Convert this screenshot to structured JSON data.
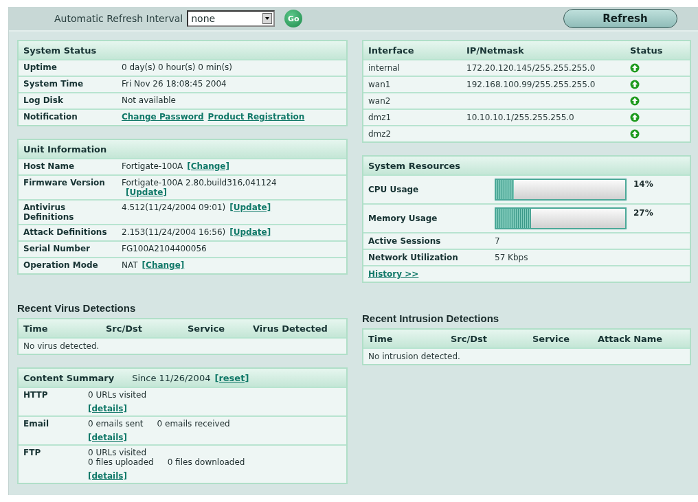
{
  "toolbar": {
    "interval_label": "Automatic Refresh Interval",
    "interval_value": "none",
    "go_button": "Go",
    "refresh_button": "Refresh"
  },
  "system_status": {
    "title": "System Status",
    "rows": [
      {
        "label": "Uptime",
        "parts": [
          {
            "kind": "text",
            "text": "0 day(s) 0 hour(s) 0 min(s)"
          }
        ]
      },
      {
        "label": "System Time",
        "parts": [
          {
            "kind": "text",
            "text": "Fri Nov 26 18:08:45 2004"
          }
        ]
      },
      {
        "label": "Log Disk",
        "parts": [
          {
            "kind": "text",
            "text": "Not available"
          }
        ]
      },
      {
        "label": "Notification",
        "parts": [
          {
            "kind": "link",
            "text": "Change Password"
          },
          {
            "kind": "link",
            "text": "Product Registration"
          }
        ]
      }
    ]
  },
  "unit_information": {
    "title": "Unit Information",
    "rows": [
      {
        "label": "Host Name",
        "parts": [
          {
            "kind": "text",
            "text": "Fortigate-100A"
          },
          {
            "kind": "link",
            "text": "[Change]"
          }
        ]
      },
      {
        "label": "Firmware Version",
        "parts": [
          {
            "kind": "text",
            "text": "Fortigate-100A 2.80,build316,041124"
          },
          {
            "kind": "link",
            "text": "[Update]",
            "newline": true
          }
        ]
      },
      {
        "label": "Antivirus Definitions",
        "parts": [
          {
            "kind": "text",
            "text": "4.512(11/24/2004 09:01)"
          },
          {
            "kind": "link",
            "text": "[Update]"
          }
        ]
      },
      {
        "label": "Attack Definitions",
        "parts": [
          {
            "kind": "text",
            "text": "2.153(11/24/2004 16:56)"
          },
          {
            "kind": "link",
            "text": "[Update]"
          }
        ]
      },
      {
        "label": "Serial Number",
        "parts": [
          {
            "kind": "text",
            "text": "FG100A2104400056"
          }
        ]
      },
      {
        "label": "Operation Mode",
        "parts": [
          {
            "kind": "text",
            "text": "NAT"
          },
          {
            "kind": "link",
            "text": "[Change]"
          }
        ]
      }
    ]
  },
  "virus_detections": {
    "title": "Recent Virus Detections",
    "columns": [
      "Time",
      "Src/Dst",
      "Service",
      "Virus Detected"
    ],
    "empty_message": "No virus detected."
  },
  "content_summary": {
    "title": "Content Summary",
    "since": "Since 11/26/2004",
    "reset_link": "[reset]",
    "rows": [
      {
        "label": "HTTP",
        "lines": [
          [
            "0 URLs visited"
          ]
        ],
        "details": "[details]"
      },
      {
        "label": "Email",
        "lines": [
          [
            "0 emails sent",
            "0 emails received"
          ]
        ],
        "details": "[details]"
      },
      {
        "label": "FTP",
        "lines": [
          [
            "0 URLs visited"
          ],
          [
            "0 files uploaded",
            "0 files downloaded"
          ]
        ],
        "details": "[details]"
      }
    ]
  },
  "interfaces": {
    "columns": [
      "Interface",
      "IP/Netmask",
      "Status"
    ],
    "rows": [
      {
        "name": "internal",
        "ip": "172.20.120.145/255.255.255.0",
        "up": true
      },
      {
        "name": "wan1",
        "ip": "192.168.100.99/255.255.255.0",
        "up": true
      },
      {
        "name": "wan2",
        "up": true
      },
      {
        "name": "dmz1",
        "ip": "10.10.10.1/255.255.255.0",
        "up": true
      },
      {
        "name": "dmz2",
        "up": true
      }
    ]
  },
  "system_resources": {
    "title": "System Resources",
    "rows": [
      {
        "kind": "meter",
        "label": "CPU Usage",
        "level": 0.14,
        "reading": "14%"
      },
      {
        "kind": "meter",
        "label": "Memory Usage",
        "level": 0.27,
        "reading": "27%"
      },
      {
        "kind": "text",
        "label": "Active Sessions",
        "value": "7"
      },
      {
        "kind": "text",
        "label": "Network Utilization",
        "value": "57 Kbps"
      }
    ],
    "history_link": "History >>"
  },
  "intrusion_detections": {
    "title": "Recent Intrusion Detections",
    "columns": [
      "Time",
      "Src/Dst",
      "Service",
      "Attack Name"
    ],
    "empty_message": "No intrusion detected."
  }
}
